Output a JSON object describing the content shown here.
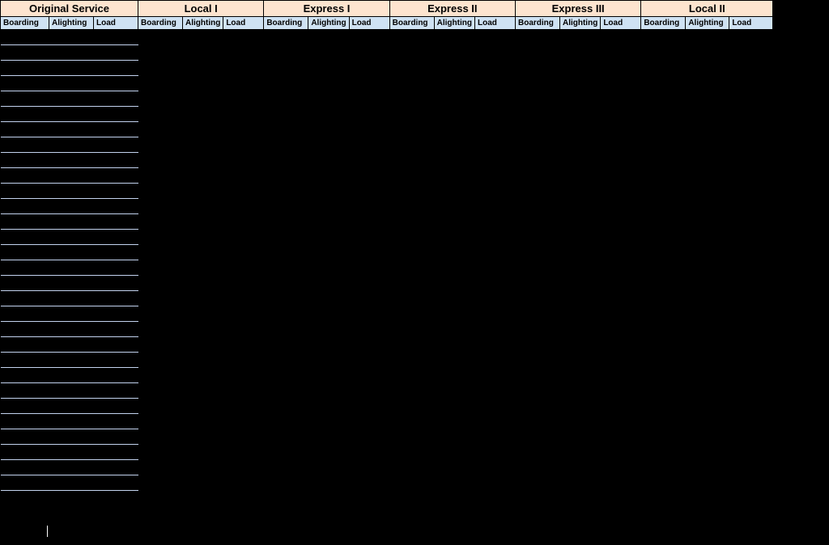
{
  "groups": [
    {
      "name": "Original Service"
    },
    {
      "name": "Local I"
    },
    {
      "name": "Express I"
    },
    {
      "name": "Express II"
    },
    {
      "name": "Express III"
    },
    {
      "name": "Local II"
    }
  ],
  "sub_columns": [
    "Boarding",
    "Alighting",
    "Load"
  ],
  "row_count": 30,
  "colors": {
    "group_bg": "#fde4cf",
    "sub_bg": "#cfe2f3",
    "orig_rule": "#c3d3ef",
    "page_bg": "#000000"
  },
  "chart_data": {
    "type": "table",
    "title": "",
    "column_groups": [
      "Original Service",
      "Local I",
      "Express I",
      "Express II",
      "Express III",
      "Local II"
    ],
    "columns_per_group": [
      "Boarding",
      "Alighting",
      "Load"
    ],
    "rows": 30,
    "note": "All data cells are blank/black in the source image; only the Original Service group shows faint row rules."
  }
}
